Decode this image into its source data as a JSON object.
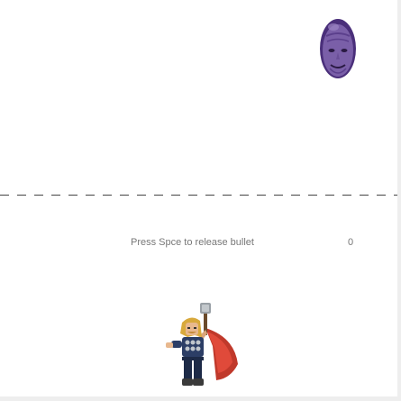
{
  "game": {
    "instruction_text": "Press Spce to release bullet",
    "score": "0",
    "enemy_sprite": "thanos-head-icon",
    "player_sprite": "thor-figure-icon"
  },
  "colors": {
    "background": "#ffffff",
    "divider": "#444444",
    "text": "#777777",
    "enemy_skin": "#7a5fa8",
    "player_cape": "#c0392b",
    "player_armor": "#2c3e66"
  }
}
